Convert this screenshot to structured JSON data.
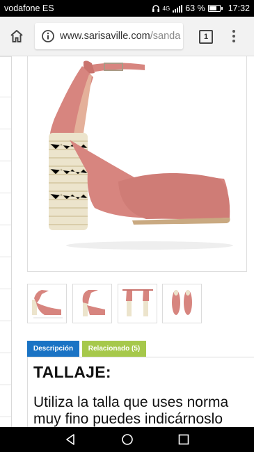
{
  "status_bar": {
    "carrier": "vodafone ES",
    "network": "4G",
    "battery": "63 %",
    "battery_level": 0.63,
    "time": "17:32"
  },
  "browser": {
    "url_host": "www.sarisaville.com",
    "url_rest": "/sanda",
    "tab_count": "1",
    "icons": [
      "home-icon",
      "info-icon",
      "tab-switcher-icon",
      "overflow-menu-icon"
    ]
  },
  "product": {
    "main_image": "pink-suede-sandal-block-heel",
    "thumbnails": [
      "sandal-side-view",
      "sandal-back-view",
      "sandal-rear-pair-view",
      "sandal-top-pair-view"
    ]
  },
  "tabs": [
    {
      "label": "Descripción",
      "active": true
    },
    {
      "label": "Relacionado (5)",
      "active": false
    }
  ],
  "description": {
    "heading": "TALLAJE:",
    "lines": [
      "Utiliza la talla que uses norma",
      "muy fino puedes indicárnoslo"
    ]
  },
  "colors": {
    "tab_active": "#1a73c4",
    "tab_related": "#a6c84b",
    "shoe_pink": "#d7857f"
  },
  "nav_bar": {
    "icons": [
      "back-icon",
      "home-circle-icon",
      "recents-icon"
    ]
  }
}
